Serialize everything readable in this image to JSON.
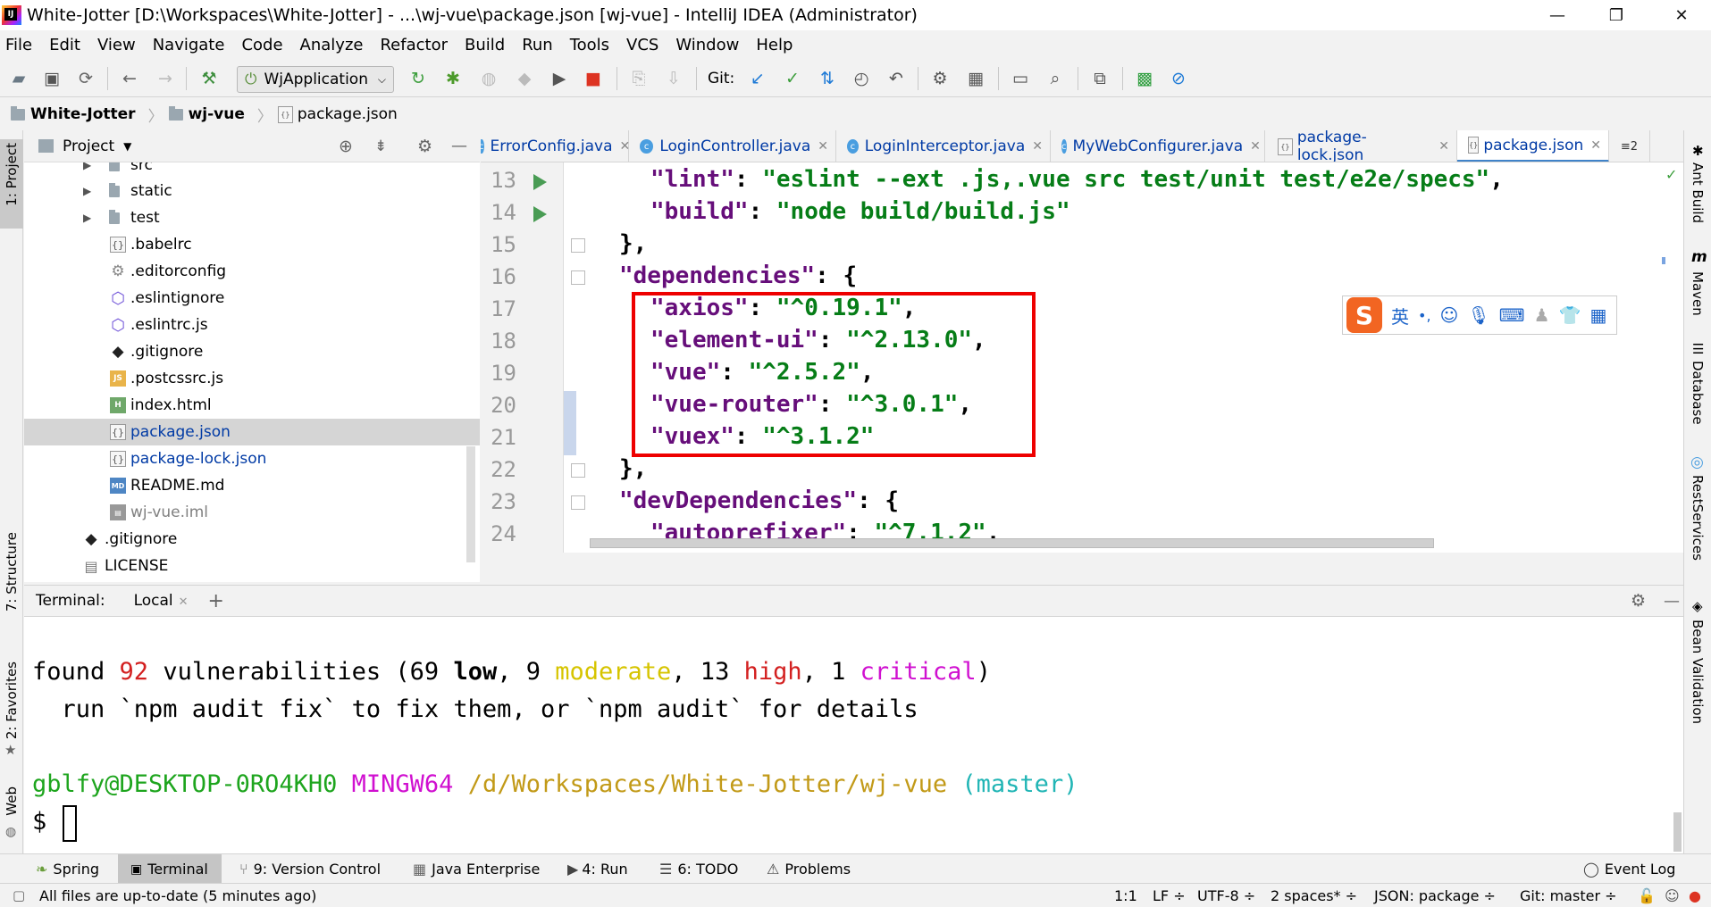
{
  "window": {
    "title": "White-Jotter [D:\\Workspaces\\White-Jotter] - ...\\wj-vue\\package.json [wj-vue] - IntelliJ IDEA (Administrator)",
    "minimize": "—",
    "restore": "❐",
    "close": "✕"
  },
  "menu": [
    "File",
    "Edit",
    "View",
    "Navigate",
    "Code",
    "Analyze",
    "Refactor",
    "Build",
    "Run",
    "Tools",
    "VCS",
    "Window",
    "Help"
  ],
  "toolbar": {
    "run_config": "WjApplication",
    "git_label": "Git:"
  },
  "breadcrumb": [
    "White-Jotter",
    "wj-vue",
    "package.json"
  ],
  "left_strip": {
    "project": "1: Project",
    "structure": "7: Structure",
    "favorites": "2: Favorites",
    "web": "Web"
  },
  "right_strip": {
    "ant": "Ant Build",
    "maven": "Maven",
    "database": "Database",
    "rest": "RestServices",
    "bean": "Bean Validation"
  },
  "project": {
    "header": "Project",
    "items": [
      {
        "label": "src",
        "type": "folder"
      },
      {
        "label": "static",
        "type": "folder"
      },
      {
        "label": "test",
        "type": "folder"
      },
      {
        "label": ".babelrc",
        "type": "json"
      },
      {
        "label": ".editorconfig",
        "type": "gear"
      },
      {
        "label": ".eslintignore",
        "type": "eslint"
      },
      {
        "label": ".eslintrc.js",
        "type": "eslint"
      },
      {
        "label": ".gitignore",
        "type": "git"
      },
      {
        "label": ".postcssrc.js",
        "type": "js"
      },
      {
        "label": "index.html",
        "type": "html"
      },
      {
        "label": "package.json",
        "type": "json"
      },
      {
        "label": "package-lock.json",
        "type": "json"
      },
      {
        "label": "README.md",
        "type": "md"
      },
      {
        "label": "wj-vue.iml",
        "type": "iml"
      },
      {
        "label": ".gitignore",
        "type": "git"
      },
      {
        "label": "LICENSE",
        "type": "text"
      }
    ]
  },
  "tabs": [
    {
      "label": "ErrorConfig.java",
      "type": "class"
    },
    {
      "label": "LoginController.java",
      "type": "class"
    },
    {
      "label": "LoginInterceptor.java",
      "type": "class"
    },
    {
      "label": "MyWebConfigurer.java",
      "type": "class"
    },
    {
      "label": "package-lock.json",
      "type": "json"
    },
    {
      "label": "package.json",
      "type": "json"
    }
  ],
  "tabs_overflow": "≡2",
  "editor": {
    "line_numbers": [
      "13",
      "14",
      "15",
      "16",
      "17",
      "18",
      "19",
      "20",
      "21",
      "22",
      "23",
      "24"
    ],
    "lines": [
      {
        "key": "\"lint\"",
        "val": "\"eslint --ext .js,.vue src test/unit test/e2e/specs\"",
        "tail": ","
      },
      {
        "key": "\"build\"",
        "val": "\"node build/build.js\"",
        "tail": ""
      },
      {
        "plain": "},"
      },
      {
        "key": "\"dependencies\"",
        "val": "",
        "tail": " {"
      },
      {
        "key": "\"axios\"",
        "val": "\"^0.19.1\"",
        "tail": ","
      },
      {
        "key": "\"element-ui\"",
        "val": "\"^2.13.0\"",
        "tail": ","
      },
      {
        "key": "\"vue\"",
        "val": "\"^2.5.2\"",
        "tail": ","
      },
      {
        "key": "\"vue-router\"",
        "val": "\"^3.0.1\"",
        "tail": ","
      },
      {
        "key": "\"vuex\"",
        "val": "\"^3.1.2\"",
        "tail": ""
      },
      {
        "plain": "},"
      },
      {
        "key": "\"devDependencies\"",
        "val": "",
        "tail": " {"
      },
      {
        "key": "\"autoprefixer\"",
        "val": "\"^7.1.2\"",
        "tail": ","
      }
    ]
  },
  "ime": {
    "logo": "S",
    "lang": "英",
    "punct": "•,"
  },
  "terminal": {
    "label": "Terminal:",
    "tab": "Local",
    "found": "found ",
    "vuln_count": "92",
    "vuln_text": " vulnerabilities (69 ",
    "low": "low",
    "sep1": ", 9 ",
    "moderate": "moderate",
    "sep2": ", 13 ",
    "high": "high",
    "sep3": ", 1 ",
    "critical": "critical",
    "close": ")",
    "hint": "  run `npm audit fix` to fix them, or `npm audit` for details",
    "user": "gblfy@DESKTOP-0RO4KH0",
    "shell": "MINGW64",
    "path": "/d/Workspaces/White-Jotter/wj-vue",
    "branch": "(master)",
    "prompt": "$"
  },
  "tool_tabs": [
    {
      "label": "Spring",
      "icon": "spring-icon"
    },
    {
      "label": "Terminal",
      "icon": "terminal-icon"
    },
    {
      "label": "9: Version Control",
      "icon": "vcs-icon"
    },
    {
      "label": "Java Enterprise",
      "icon": "javaee-icon"
    },
    {
      "label": "4: Run",
      "icon": "run-icon"
    },
    {
      "label": "6: TODO",
      "icon": "todo-icon"
    },
    {
      "label": "Problems",
      "icon": "warning-icon"
    }
  ],
  "event_log": "Event Log",
  "status": {
    "message": "All files are up-to-date (5 minutes ago)",
    "position": "1:1",
    "line_sep": "LF ÷",
    "encoding": "UTF-8 ÷",
    "indent": "2 spaces* ÷",
    "schema": "JSON: package ÷",
    "git": "Git: master ÷"
  },
  "colors": {
    "json_key": "#660e7a",
    "json_string": "#067d17",
    "highlight_box": "#ee0000",
    "accent": "#4083c9"
  }
}
